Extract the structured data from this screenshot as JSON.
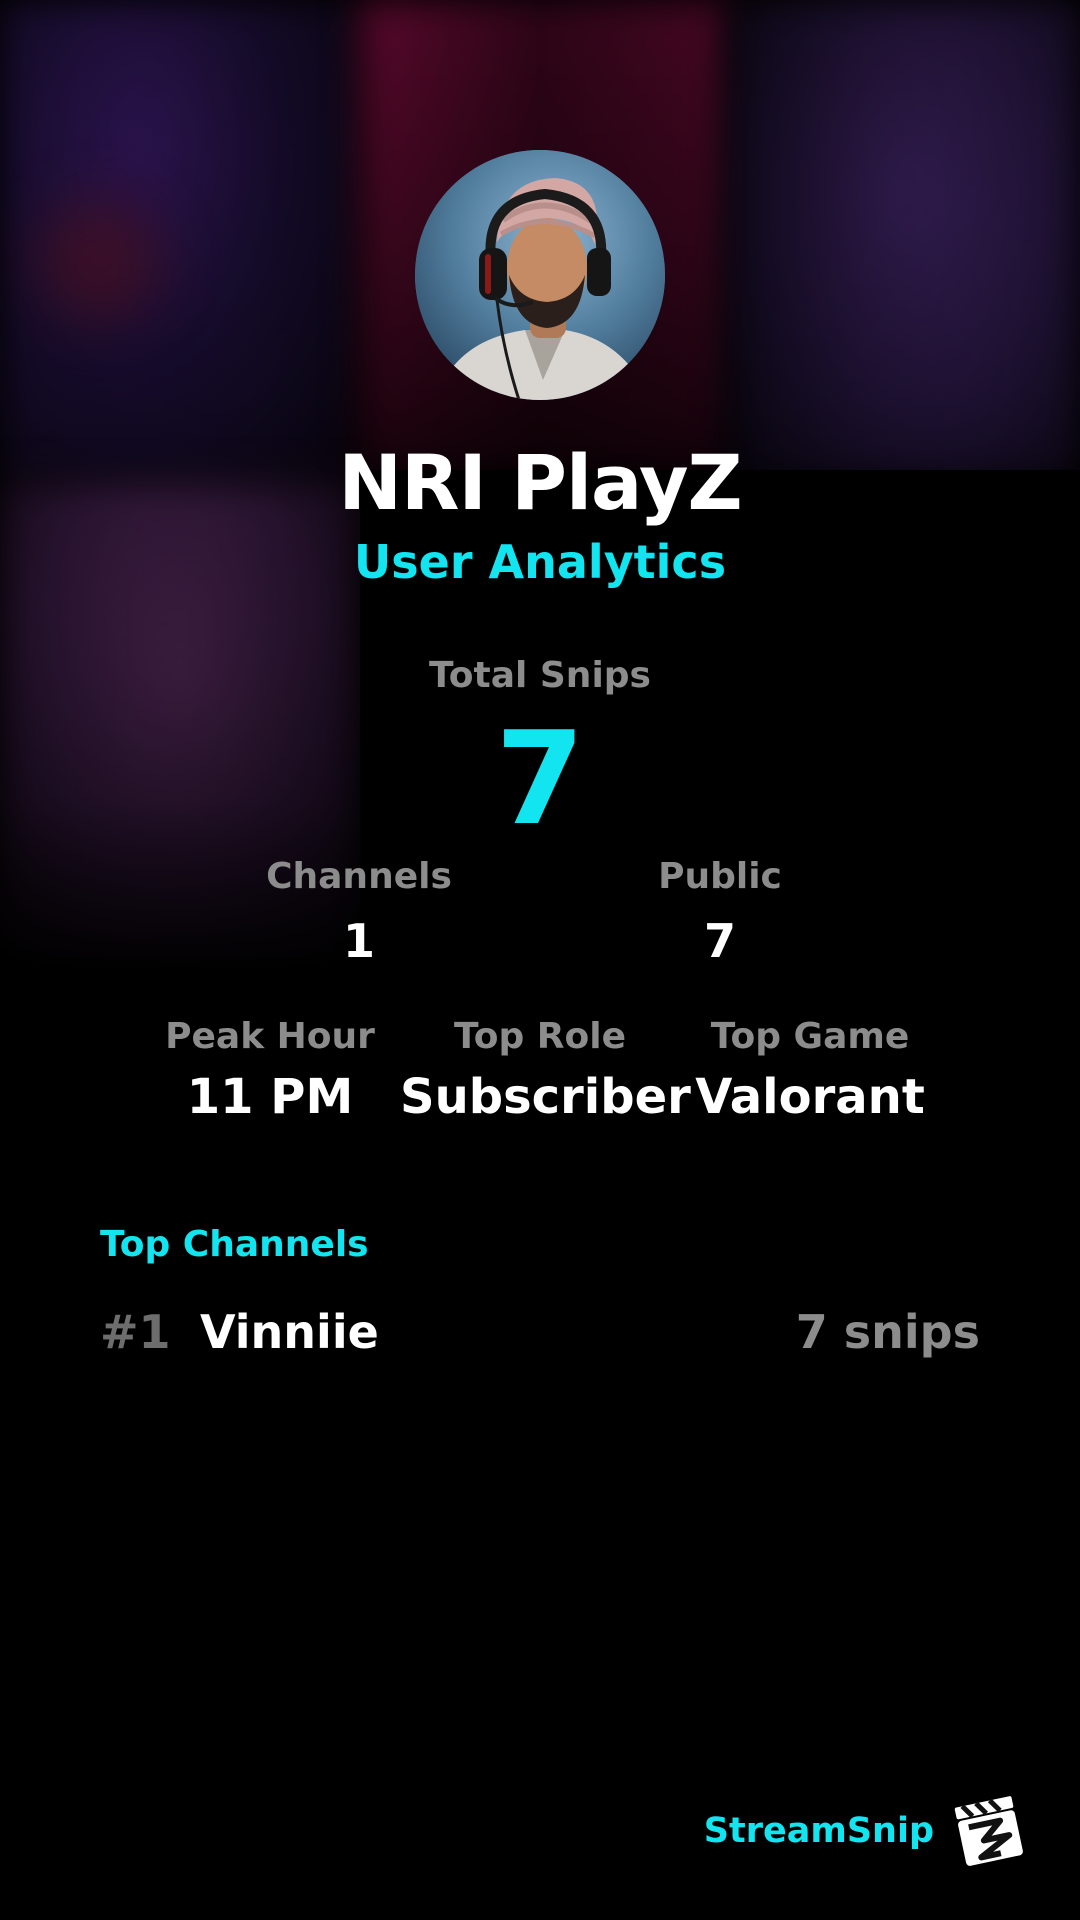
{
  "profile": {
    "username": "NRI PlayZ",
    "subtitle": "User Analytics",
    "avatar_icon": "user-avatar-headset"
  },
  "stats": {
    "total_snips": {
      "label": "Total Snips",
      "value": "7"
    },
    "channels": {
      "label": "Channels",
      "value": "1"
    },
    "public": {
      "label": "Public",
      "value": "7"
    },
    "peak_hour": {
      "label": "Peak Hour",
      "value": "11 PM"
    },
    "top_role": {
      "label": "Top Role",
      "value": "Subscriber"
    },
    "top_game": {
      "label": "Top Game",
      "value": "Valorant"
    }
  },
  "top_channels": {
    "title": "Top Channels",
    "items": [
      {
        "rank": "#1",
        "name": "Vinniie",
        "count": "7 snips"
      }
    ]
  },
  "brand": {
    "name": "StreamSnip",
    "logo_icon": "clapperboard-icon"
  },
  "colors": {
    "accent": "#12e4f0",
    "background": "#000000",
    "label": "#8c8c8c",
    "value": "#ffffff"
  }
}
